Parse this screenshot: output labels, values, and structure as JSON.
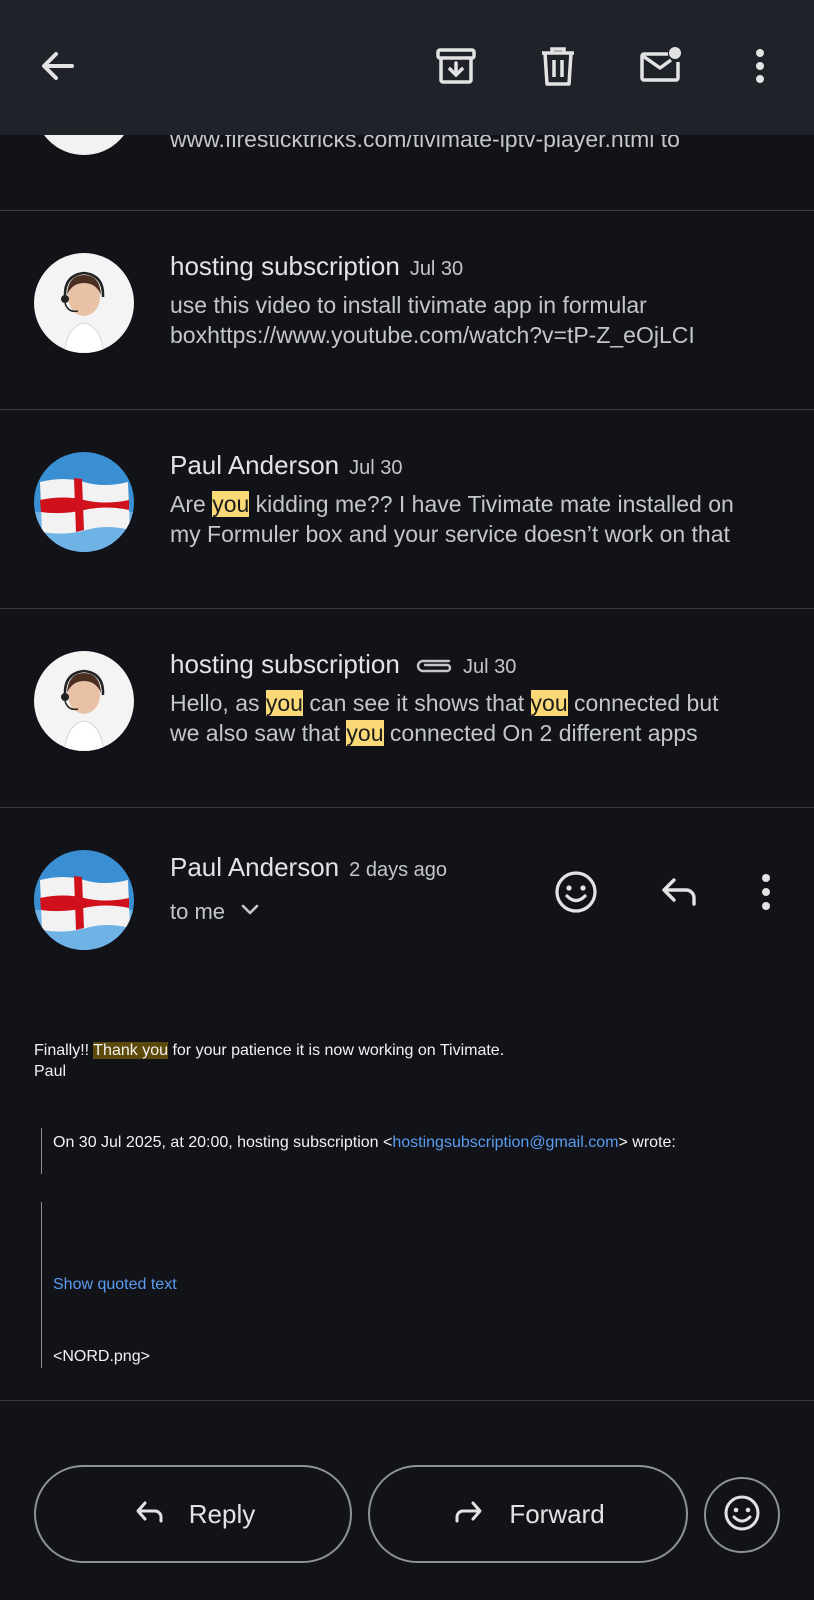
{
  "toolbar": {
    "icons": [
      "back-arrow-icon",
      "archive-icon",
      "delete-icon",
      "mark-unread-icon",
      "more-vert-icon"
    ]
  },
  "cut_message": {
    "snippet": "www.firesticktricks.com/tivimate-iptv-player.html to"
  },
  "threads": [
    {
      "sender": "hosting subscription",
      "date": "Jul 30",
      "line1": "use this video to install tivimate app in formular",
      "line2": "boxhttps://www.youtube.com/watch?v=tP-Z_eOjLCI"
    },
    {
      "sender": "Paul Anderson",
      "date": "Jul 30",
      "line1_pre": "Are ",
      "line1_hl": "you",
      "line1_post": " kidding me?? I have Tivimate mate installed on",
      "line2": "my Formuler box and your service doesn’t work on that"
    },
    {
      "sender": "hosting subscription",
      "date": "Jul 30",
      "line1_a": "Hello, as ",
      "line1_hl1": "you",
      "line1_b": " can see it shows that ",
      "line1_hl2": "you",
      "line1_c": " connected but",
      "line2_a": "we also saw that ",
      "line2_hl": "you",
      "line2_b": " connected On 2 different apps"
    }
  ],
  "open_message": {
    "sender": "Paul Anderson",
    "date": "2 days ago",
    "recipient": "to me",
    "body_pre": "Finally!! ",
    "body_hl": "Thank you",
    "body_post": " for your patience it is now working on Tivimate.",
    "signature": "Paul",
    "quote_pre": "On 30 Jul 2025, at 20:00, hosting subscription <",
    "quote_email": "hostingsubscription@gmail.com",
    "quote_post": "> wrote:",
    "show_quoted": "Show quoted text",
    "attachment_text": "<NORD.png>"
  },
  "actions": {
    "reply_label": "Reply",
    "forward_label": "Forward"
  },
  "colors": {
    "background": "#111318",
    "toolbar": "#1f2229",
    "highlight": "#fbd977",
    "link": "#5b9cf0"
  }
}
